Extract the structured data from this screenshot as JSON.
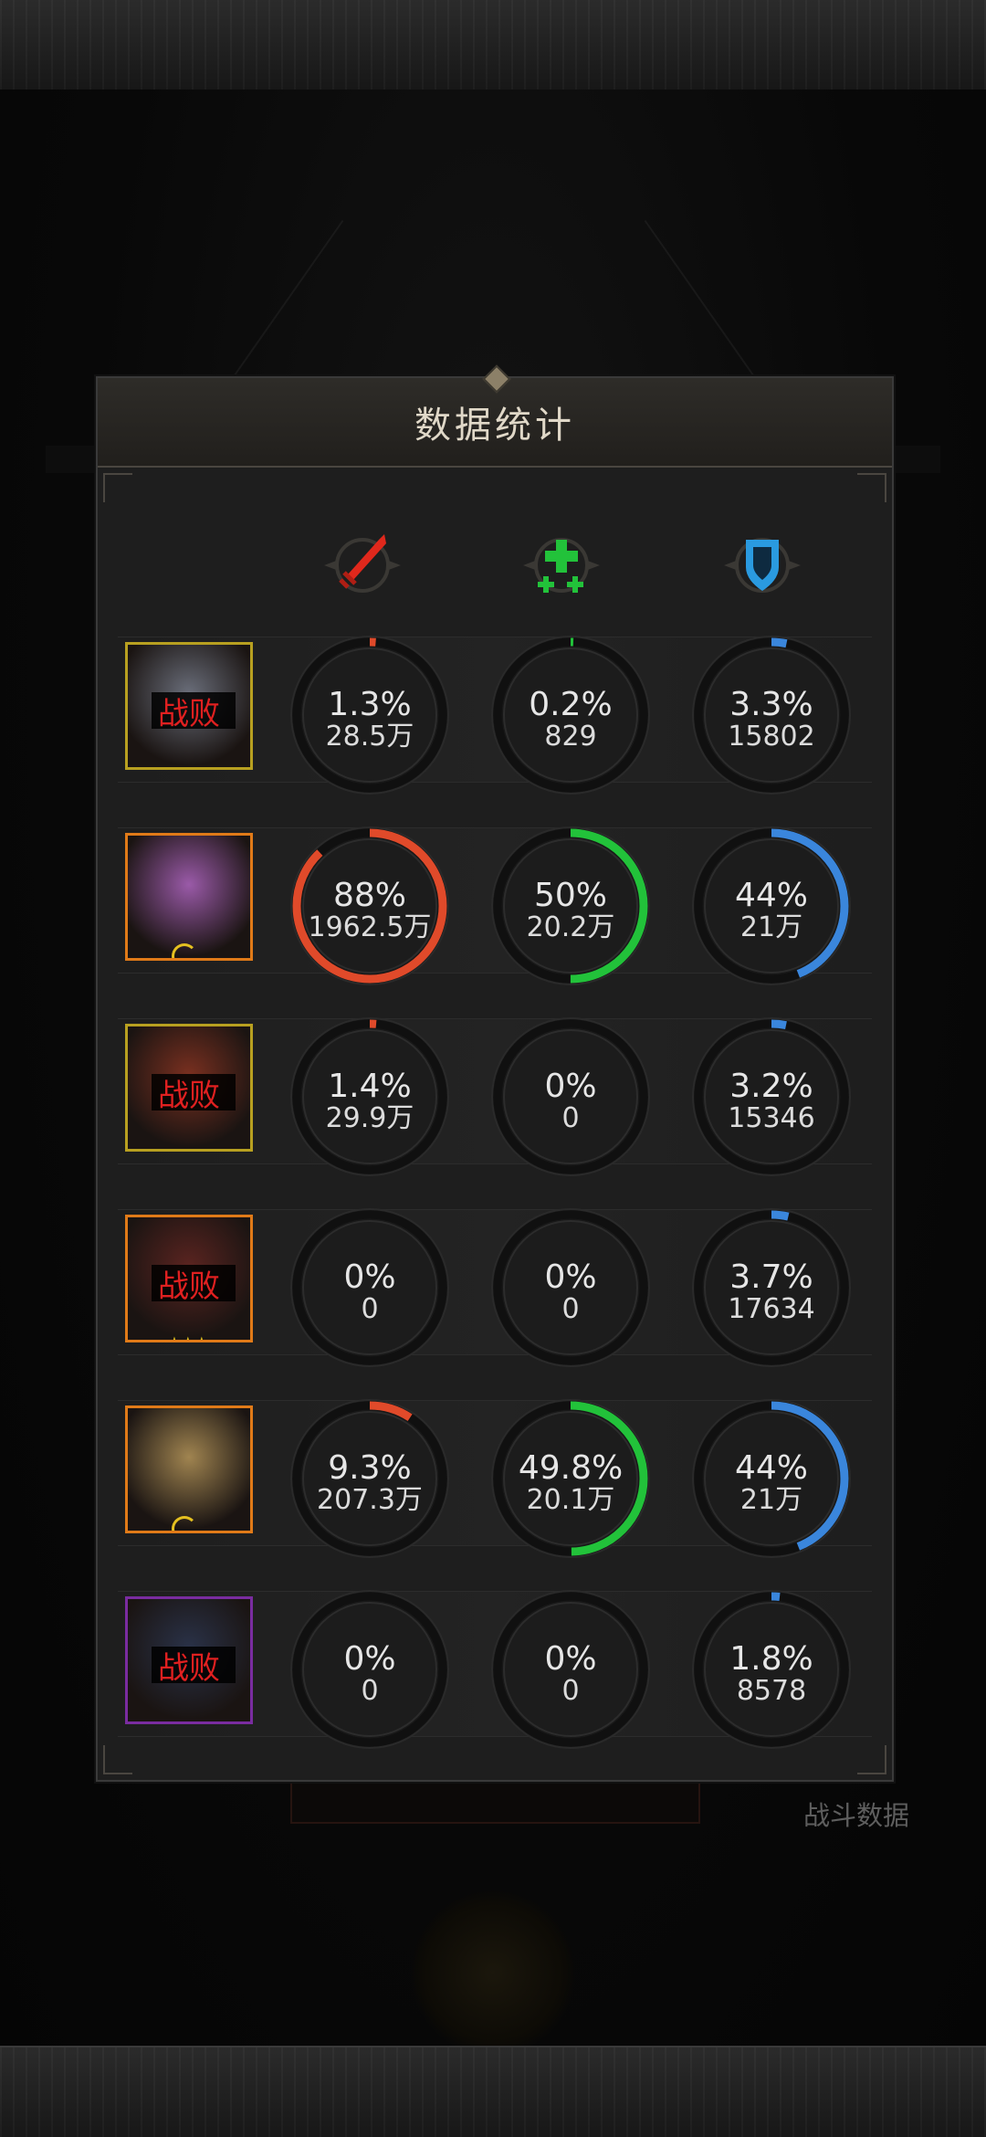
{
  "header_dialog": {
    "title": "数据统计"
  },
  "background": {
    "battle_data_label": "战斗数据"
  },
  "columns": [
    {
      "name": "damage",
      "icon": "sword-icon",
      "color": "#e04a2a"
    },
    {
      "name": "heal",
      "icon": "heal-cross-icon",
      "color": "#22c23a"
    },
    {
      "name": "tank",
      "icon": "shield-icon",
      "color": "#3a86dc"
    }
  ],
  "rows": [
    {
      "portrait_color": "#6a6e7a",
      "frame": "gold",
      "defeated": true,
      "defeat_label": "战败",
      "badge": "",
      "stats": [
        {
          "pct": "1.3%",
          "val": "28.5万",
          "frac": 0.013
        },
        {
          "pct": "0.2%",
          "val": "829",
          "frac": 0.002
        },
        {
          "pct": "3.3%",
          "val": "15802",
          "frac": 0.033
        }
      ]
    },
    {
      "portrait_color": "#9a5aa8",
      "frame": "orange",
      "defeated": false,
      "defeat_label": "",
      "badge": "moon",
      "stats": [
        {
          "pct": "88%",
          "val": "1962.5万",
          "frac": 0.88
        },
        {
          "pct": "50%",
          "val": "20.2万",
          "frac": 0.5
        },
        {
          "pct": "44%",
          "val": "21万",
          "frac": 0.44
        }
      ]
    },
    {
      "portrait_color": "#7a3020",
      "frame": "gold",
      "defeated": true,
      "defeat_label": "战败",
      "badge": "",
      "stats": [
        {
          "pct": "1.4%",
          "val": "29.9万",
          "frac": 0.014
        },
        {
          "pct": "0%",
          "val": "0",
          "frac": 0
        },
        {
          "pct": "3.2%",
          "val": "15346",
          "frac": 0.032
        }
      ]
    },
    {
      "portrait_color": "#5a2420",
      "frame": "orange",
      "defeated": true,
      "defeat_label": "战败",
      "badge": "stars",
      "stats": [
        {
          "pct": "0%",
          "val": "0",
          "frac": 0
        },
        {
          "pct": "0%",
          "val": "0",
          "frac": 0
        },
        {
          "pct": "3.7%",
          "val": "17634",
          "frac": 0.037
        }
      ]
    },
    {
      "portrait_color": "#a08450",
      "frame": "orange",
      "defeated": false,
      "defeat_label": "",
      "badge": "moon",
      "stats": [
        {
          "pct": "9.3%",
          "val": "207.3万",
          "frac": 0.093
        },
        {
          "pct": "49.8%",
          "val": "20.1万",
          "frac": 0.498
        },
        {
          "pct": "44%",
          "val": "21万",
          "frac": 0.44
        }
      ]
    },
    {
      "portrait_color": "#2a3248",
      "frame": "purple",
      "defeated": true,
      "defeat_label": "战败",
      "badge": "",
      "stats": [
        {
          "pct": "0%",
          "val": "0",
          "frac": 0
        },
        {
          "pct": "0%",
          "val": "0",
          "frac": 0
        },
        {
          "pct": "1.8%",
          "val": "8578",
          "frac": 0.018
        }
      ]
    }
  ]
}
